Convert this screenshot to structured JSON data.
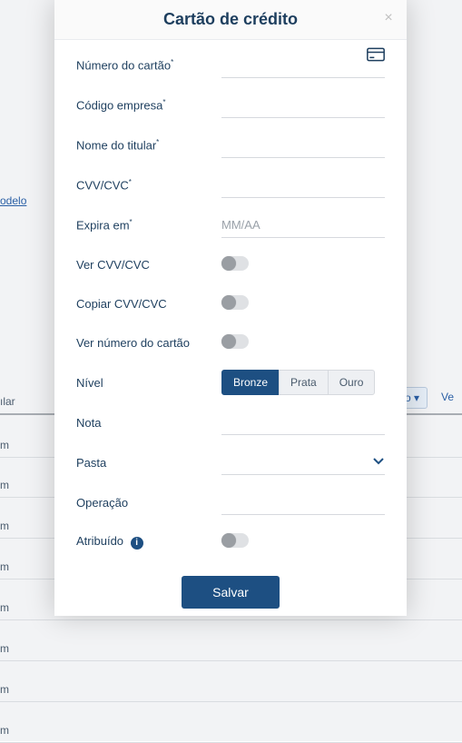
{
  "background": {
    "link": "odelo",
    "col_lhs": "ılar",
    "col_rhs_1": "do",
    "col_rhs_2": "Ve",
    "row_val": "m"
  },
  "modal": {
    "title": "Cartão de crédito",
    "fields": {
      "card_number": {
        "label": "Número do cartão"
      },
      "company_code": {
        "label": "Código empresa"
      },
      "cardholder": {
        "label": "Nome do titular"
      },
      "cvv": {
        "label": "CVV/CVC"
      },
      "expires": {
        "label": "Expira em",
        "placeholder": "MM/AA"
      },
      "show_cvv": {
        "label": "Ver CVV/CVC"
      },
      "copy_cvv": {
        "label": "Copiar CVV/CVC"
      },
      "show_number": {
        "label": "Ver número do cartão"
      },
      "level": {
        "label": "Nível",
        "options": [
          "Bronze",
          "Prata",
          "Ouro"
        ],
        "selected": "Bronze"
      },
      "note": {
        "label": "Nota"
      },
      "folder": {
        "label": "Pasta"
      },
      "operation": {
        "label": "Operação"
      },
      "assigned": {
        "label": "Atribuído"
      }
    },
    "save": "Salvar"
  }
}
